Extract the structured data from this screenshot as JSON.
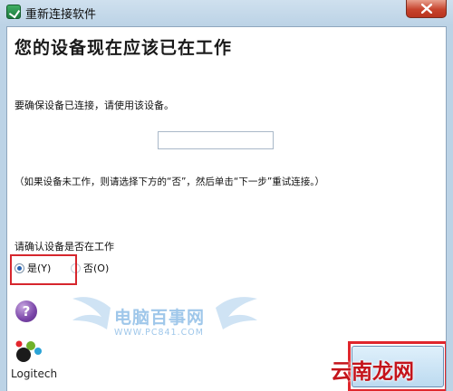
{
  "window": {
    "title": "重新连接软件"
  },
  "main": {
    "heading": "您的设备现在应该已在工作",
    "instruction": "要确保设备已连接，请使用该设备。",
    "code_value": "",
    "note": "（如果设备未工作，则请选择下方的“否”，然后单击“下一步”重试连接。）",
    "confirm_question": "请确认设备是否在工作",
    "radio_yes": "是(Y)",
    "radio_no": "否(O)"
  },
  "footer": {
    "logo_text": "Logitech",
    "help_symbol": "?",
    "watermark": {
      "title": "电脑百事网",
      "url": "WWW.PC841.COM"
    },
    "brand_watermark": "云南龙网"
  },
  "colors": {
    "highlight_box": "#d6262d",
    "brand_red": "#c4141b"
  }
}
